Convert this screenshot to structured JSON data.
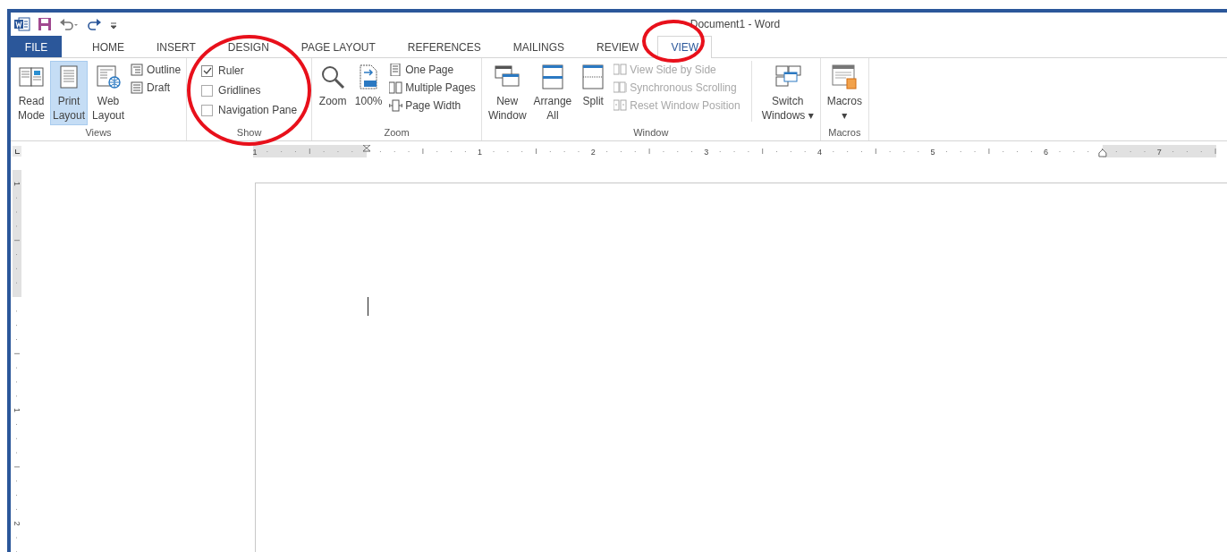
{
  "window": {
    "title": "Document1 - Word"
  },
  "tabs": [
    {
      "label": "FILE",
      "kind": "file",
      "selected": false,
      "circled": false
    },
    {
      "label": "HOME",
      "kind": "tab",
      "selected": false,
      "circled": false
    },
    {
      "label": "INSERT",
      "kind": "tab",
      "selected": false,
      "circled": false
    },
    {
      "label": "DESIGN",
      "kind": "tab",
      "selected": false,
      "circled": false
    },
    {
      "label": "PAGE LAYOUT",
      "kind": "tab",
      "selected": false,
      "circled": false
    },
    {
      "label": "REFERENCES",
      "kind": "tab",
      "selected": false,
      "circled": false
    },
    {
      "label": "MAILINGS",
      "kind": "tab",
      "selected": false,
      "circled": false
    },
    {
      "label": "REVIEW",
      "kind": "tab",
      "selected": false,
      "circled": false
    },
    {
      "label": "VIEW",
      "kind": "tab",
      "selected": true,
      "circled": true
    }
  ],
  "ribbon": {
    "groups": [
      {
        "label": "Views",
        "circled": false,
        "controls": [
          {
            "kind": "large",
            "lines": [
              "Read",
              "Mode"
            ],
            "selected": false
          },
          {
            "kind": "large",
            "lines": [
              "Print",
              "Layout"
            ],
            "selected": true
          },
          {
            "kind": "large",
            "lines": [
              "Web",
              "Layout"
            ],
            "selected": false
          },
          {
            "kind": "small",
            "label": "Outline",
            "disabled": false
          },
          {
            "kind": "small",
            "label": "Draft",
            "disabled": false
          }
        ]
      },
      {
        "label": "Show",
        "circled": true,
        "controls": [
          {
            "kind": "check",
            "label": "Ruler",
            "checked": true
          },
          {
            "kind": "check",
            "label": "Gridlines",
            "checked": false
          },
          {
            "kind": "check",
            "label": "Navigation Pane",
            "checked": false
          }
        ]
      },
      {
        "label": "Zoom",
        "circled": false,
        "controls": [
          {
            "kind": "large",
            "lines": [
              "Zoom"
            ],
            "selected": false
          },
          {
            "kind": "large",
            "lines": [
              "100%"
            ],
            "selected": false
          },
          {
            "kind": "small",
            "label": "One Page",
            "disabled": false
          },
          {
            "kind": "small",
            "label": "Multiple Pages",
            "disabled": false
          },
          {
            "kind": "small",
            "label": "Page Width",
            "disabled": false
          }
        ]
      },
      {
        "label": "Window",
        "circled": false,
        "controls": [
          {
            "kind": "large",
            "lines": [
              "New",
              "Window"
            ],
            "selected": false
          },
          {
            "kind": "large",
            "lines": [
              "Arrange",
              "All"
            ],
            "selected": false
          },
          {
            "kind": "large",
            "lines": [
              "Split"
            ],
            "selected": false
          },
          {
            "kind": "small",
            "label": "View Side by Side",
            "disabled": true
          },
          {
            "kind": "small",
            "label": "Synchronous Scrolling",
            "disabled": true
          },
          {
            "kind": "small",
            "label": "Reset Window Position",
            "disabled": true
          },
          {
            "kind": "separator"
          },
          {
            "kind": "large",
            "lines": [
              "Switch",
              "Windows ▾"
            ],
            "selected": false
          }
        ]
      },
      {
        "label": "Macros",
        "circled": false,
        "controls": [
          {
            "kind": "large",
            "lines": [
              "Macros",
              "▾"
            ],
            "selected": false
          }
        ]
      }
    ]
  },
  "ruler": {
    "numbers": [
      "1",
      "1",
      "2",
      "3",
      "4",
      "5",
      "6",
      "7"
    ]
  },
  "vertical_ruler": {
    "numbers": [
      "1",
      "1",
      "2"
    ]
  }
}
